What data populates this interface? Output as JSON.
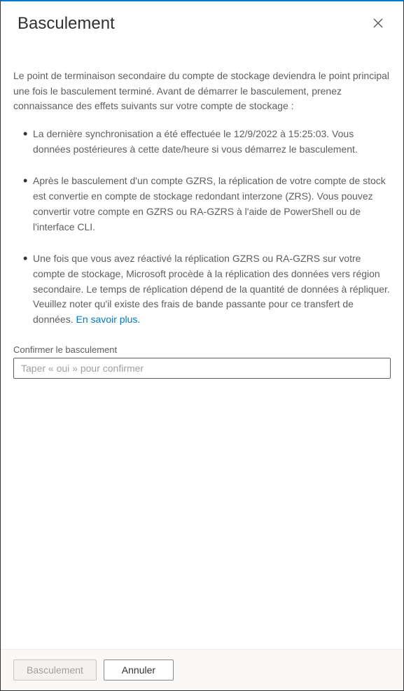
{
  "header": {
    "title": "Basculement"
  },
  "intro": "Le point de terminaison secondaire du compte de stockage deviendra le point principal une fois le basculement terminé. Avant de démarrer le basculement, prenez connaissance des effets suivants sur votre compte de stockage :",
  "bullets": {
    "b1_part1": "La dernière synchronisation a été effectuée le 12/9/2022 à 15:25:03. Vous données postérieures à cette date/heure si vous démarrez le basculement.",
    "b2_part1": "Après le basculement d'un compte GZRS, la réplication de votre compte de stock est convertie en compte de stockage redondant interzone (ZRS). Vous pouvez convertir votre compte en GZRS ou RA-GZRS à l'aide de PowerShell ou de l'interface CLI.",
    "b3_part1": "Une fois que vous avez réactivé la réplication GZRS ou RA-GZRS sur votre compte de stockage, Microsoft procède à la réplication des données vers région secondaire. Le temps de réplication dépend de la quantité de données à répliquer. Veuillez noter qu'il existe des frais de bande passante pour ce transfert de données. ",
    "b3_link": "En savoir plus."
  },
  "confirm": {
    "label": "Confirmer le basculement",
    "placeholder": "Taper « oui » pour confirmer"
  },
  "footer": {
    "primary": "Basculement",
    "secondary": "Annuler"
  }
}
